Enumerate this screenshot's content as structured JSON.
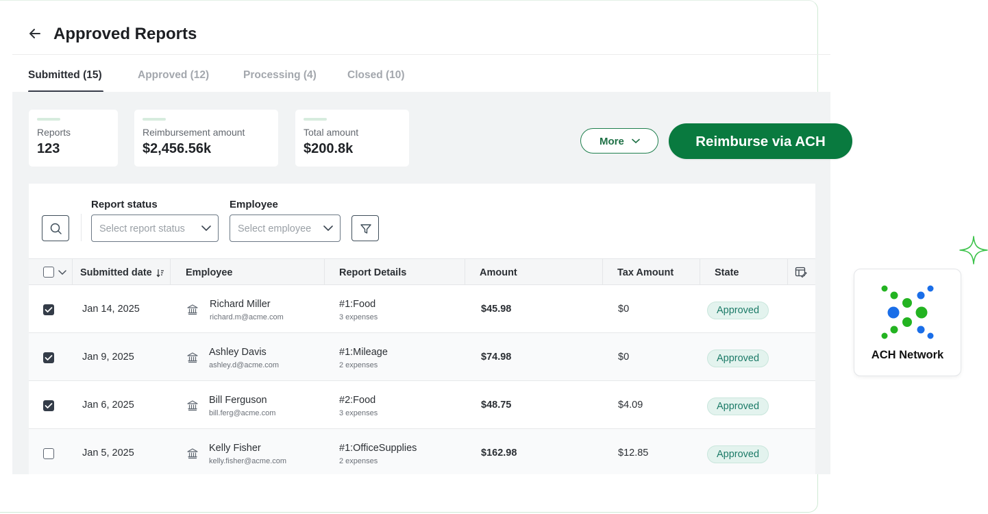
{
  "page": {
    "title": "Approved Reports"
  },
  "tabs": [
    {
      "label": "Submitted (15)",
      "active": true
    },
    {
      "label": "Approved (12)",
      "active": false
    },
    {
      "label": "Processing (4)",
      "active": false
    },
    {
      "label": "Closed (10)",
      "active": false
    }
  ],
  "stats": [
    {
      "label": "Reports",
      "value": "123"
    },
    {
      "label": "Reimbursement amount",
      "value": "$2,456.56k"
    },
    {
      "label": "Total amount",
      "value": "$200.8k"
    }
  ],
  "actions": {
    "more_label": "More",
    "reimburse_label": "Reimburse via ACH"
  },
  "filters": {
    "status_label": "Report status",
    "status_placeholder": "Select report status",
    "employee_label": "Employee",
    "employee_placeholder": "Select employee"
  },
  "table": {
    "columns": [
      "Submitted date",
      "Employee",
      "Report Details",
      "Amount",
      "Tax Amount",
      "State"
    ],
    "rows": [
      {
        "checked": true,
        "date": "Jan 14, 2025",
        "name": "Richard Miller",
        "email": "richard.m@acme.com",
        "report": "#1:Food",
        "expenses": "3 expenses",
        "amount": "$45.98",
        "tax": "$0",
        "state": "Approved"
      },
      {
        "checked": true,
        "date": "Jan 9, 2025",
        "name": "Ashley Davis",
        "email": "ashley.d@acme.com",
        "report": "#1:Mileage",
        "expenses": "2 expenses",
        "amount": "$74.98",
        "tax": "$0",
        "state": "Approved"
      },
      {
        "checked": true,
        "date": "Jan 6, 2025",
        "name": "Bill Ferguson",
        "email": "bill.ferg@acme.com",
        "report": "#2:Food",
        "expenses": "3 expenses",
        "amount": "$48.75",
        "tax": "$4.09",
        "state": "Approved"
      },
      {
        "checked": false,
        "date": "Jan 5, 2025",
        "name": "Kelly Fisher",
        "email": "kelly.fisher@acme.com",
        "report": "#1:OfficeSupplies",
        "expenses": "2 expenses",
        "amount": "$162.98",
        "tax": "$12.85",
        "state": "Approved"
      }
    ]
  },
  "logo": {
    "text": "ACH Network"
  },
  "colors": {
    "accent": "#097a3f",
    "badge_bg": "#e3f3ee",
    "badge_text": "#1b7a67",
    "logo_blue": "#1a6ee8",
    "logo_green": "#23b321"
  },
  "icons": [
    "back-arrow-icon",
    "search-icon",
    "chevron-down-icon",
    "filter-icon",
    "sort-icon",
    "column-settings-icon",
    "bank-icon",
    "sparkle-icon"
  ]
}
